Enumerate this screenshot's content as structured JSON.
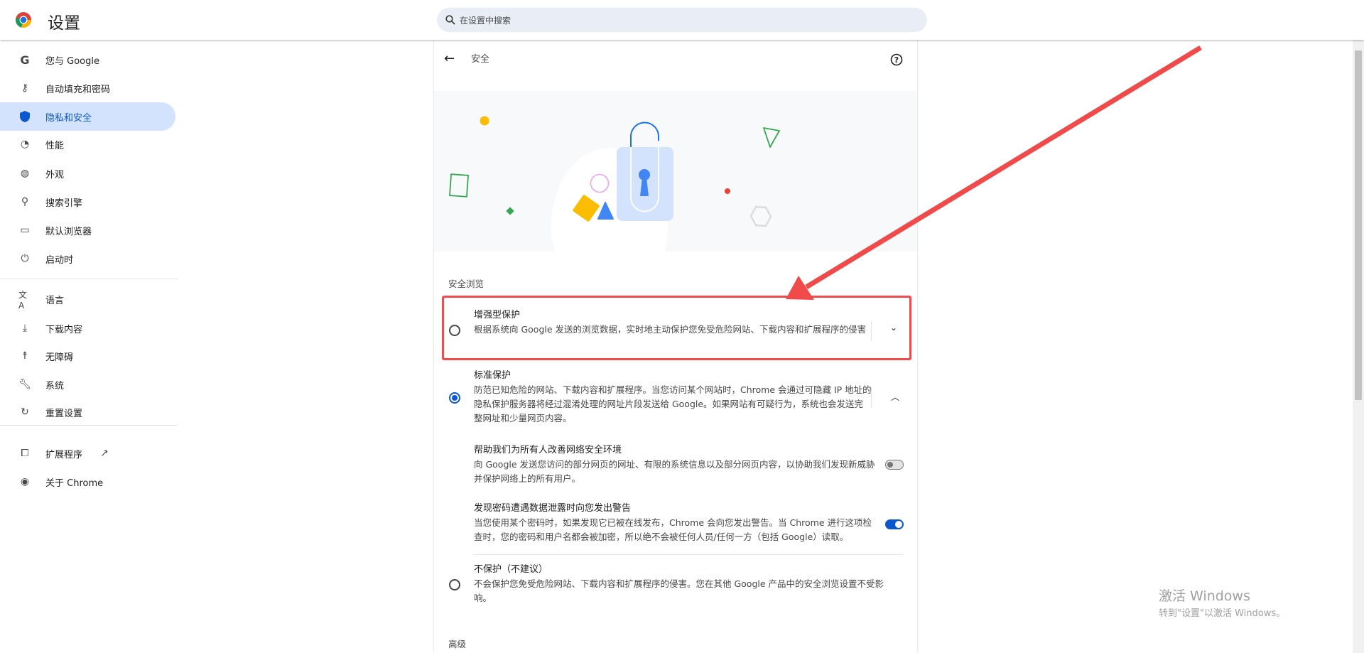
{
  "header": {
    "title": "设置",
    "search_placeholder": "在设置中搜索"
  },
  "sidebar": {
    "items": [
      {
        "label": "您与 Google",
        "icon": "google-icon"
      },
      {
        "label": "自动填充和密码",
        "icon": "key-icon"
      },
      {
        "label": "隐私和安全",
        "icon": "shield-icon",
        "active": true
      },
      {
        "label": "性能",
        "icon": "speedometer-icon"
      },
      {
        "label": "外观",
        "icon": "palette-icon"
      },
      {
        "label": "搜索引擎",
        "icon": "search-icon"
      },
      {
        "label": "默认浏览器",
        "icon": "browser-icon"
      },
      {
        "label": "启动时",
        "icon": "power-icon"
      },
      {
        "label": "语言",
        "icon": "translate-icon"
      },
      {
        "label": "下载内容",
        "icon": "download-icon"
      },
      {
        "label": "无障碍",
        "icon": "accessibility-icon"
      },
      {
        "label": "系统",
        "icon": "wrench-icon"
      },
      {
        "label": "重置设置",
        "icon": "reset-icon"
      },
      {
        "label": "扩展程序",
        "icon": "puzzle-icon"
      },
      {
        "label": "关于 Chrome",
        "icon": "chrome-icon"
      }
    ]
  },
  "page": {
    "title": "安全",
    "section": "安全浏览",
    "enhanced": {
      "title": "增强型保护",
      "desc": "根据系统向 Google 发送的浏览数据，实时地主动保护您免受危险网站、下载内容和扩展程序的侵害",
      "selected": false
    },
    "standard": {
      "title": "标准保护",
      "desc": "防范已知危险的网站、下载内容和扩展程序。当您访问某个网站时，Chrome 会通过可隐藏 IP 地址的隐私保护服务器将经过混淆处理的网址片段发送给 Google。如果网站有可疑行为，系统也会发送完整网址和少量网页内容。",
      "selected": true
    },
    "help": {
      "title": "帮助我们为所有人改善网络安全环境",
      "desc": "向 Google 发送您访问的部分网页的网址、有限的系统信息以及部分网页内容，以协助我们发现新威胁并保护网络上的所有用户。",
      "enabled": false
    },
    "password": {
      "title": "发现密码遭遇数据泄露时向您发出警告",
      "desc": "当您使用某个密码时，如果发现它已被在线发布，Chrome 会向您发出警告。当 Chrome 进行这项检查时，您的密码和用户名都会被加密，所以绝不会被任何人员/任何一方（包括 Google）读取。",
      "enabled": true
    },
    "none": {
      "title": "不保护（不建议）",
      "desc": "不会保护您免受危险网站、下载内容和扩展程序的侵害。您在其他 Google 产品中的安全浏览设置不受影响。",
      "selected": false
    },
    "advanced": "高级"
  },
  "watermark": {
    "line1": "激活 Windows",
    "line2": "转到\"设置\"以激活 Windows。"
  },
  "colors": {
    "accent": "#0b57d0",
    "annotation": "#f04a4a"
  }
}
